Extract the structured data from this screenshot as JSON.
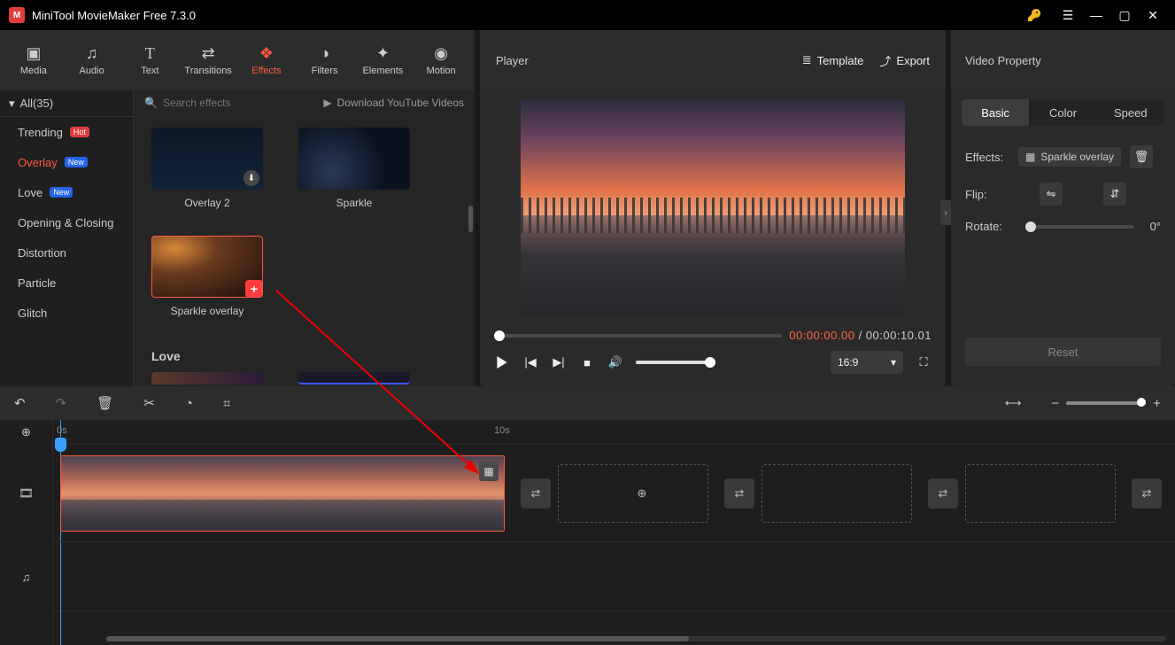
{
  "app": {
    "title": "MiniTool MovieMaker Free 7.3.0"
  },
  "toolbar": {
    "items": [
      {
        "label": "Media"
      },
      {
        "label": "Audio"
      },
      {
        "label": "Text"
      },
      {
        "label": "Transitions"
      },
      {
        "label": "Effects"
      },
      {
        "label": "Filters"
      },
      {
        "label": "Elements"
      },
      {
        "label": "Motion"
      }
    ]
  },
  "sidebar": {
    "header": "All(35)",
    "items": [
      {
        "label": "Trending",
        "badge": "Hot",
        "badgeClass": "hot"
      },
      {
        "label": "Overlay",
        "badge": "New",
        "badgeClass": "new"
      },
      {
        "label": "Love",
        "badge": "New",
        "badgeClass": "new"
      },
      {
        "label": "Opening & Closing"
      },
      {
        "label": "Distortion"
      },
      {
        "label": "Particle"
      },
      {
        "label": "Glitch"
      }
    ]
  },
  "content": {
    "search_placeholder": "Search effects",
    "download_link": "Download YouTube Videos",
    "effects": [
      {
        "label": "Overlay 2"
      },
      {
        "label": "Sparkle"
      },
      {
        "label": "Sparkle overlay"
      }
    ],
    "section2": "Love"
  },
  "player": {
    "title": "Player",
    "template_btn": "Template",
    "export_btn": "Export",
    "current_time": "00:00:00.00",
    "sep": " / ",
    "total_time": "00:00:10.01",
    "aspect": "16:9"
  },
  "props": {
    "title": "Video Property",
    "tabs": [
      "Basic",
      "Color",
      "Speed"
    ],
    "effects_label": "Effects:",
    "effect_value": "Sparkle overlay",
    "flip_label": "Flip:",
    "rotate_label": "Rotate:",
    "rotate_value": "0°",
    "reset": "Reset"
  },
  "timeline": {
    "marks": [
      "0s",
      "10s"
    ]
  }
}
